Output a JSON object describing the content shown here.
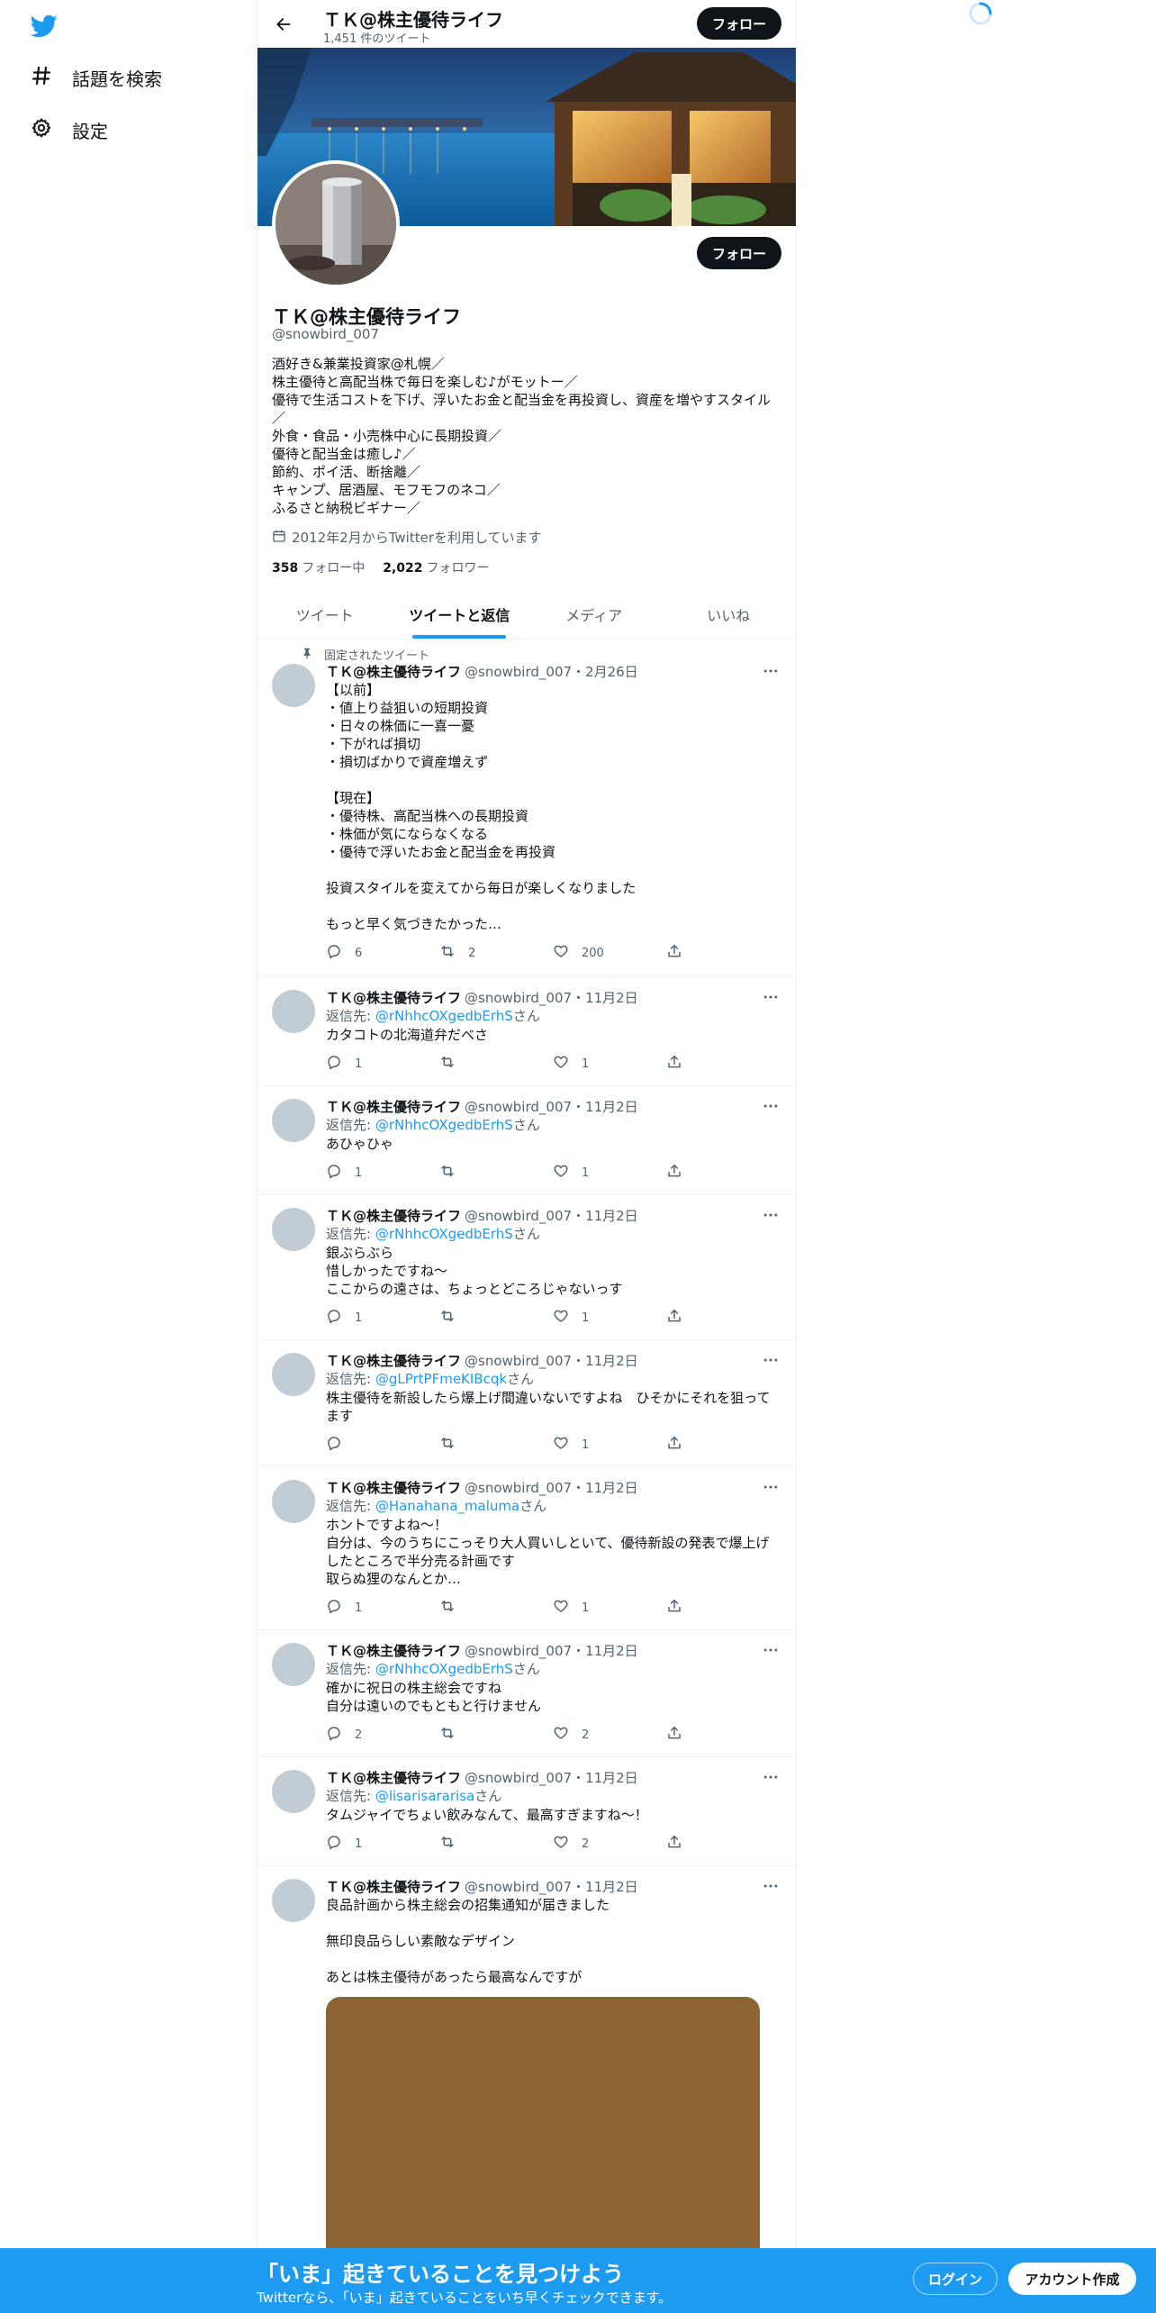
{
  "nav": {
    "logo_icon": "twitter-bird-icon",
    "items": [
      {
        "label": "話題を検索",
        "icon": "hashtag-icon"
      },
      {
        "label": "設定",
        "icon": "gear-icon"
      }
    ]
  },
  "header": {
    "title": "ＴＫ@株主優待ライフ",
    "tweet_count": "1,451 件のツイート",
    "follow_label": "フォロー"
  },
  "profile": {
    "name": "ＴＫ@株主優待ライフ",
    "handle": "@snowbird_007",
    "follow_label": "フォロー",
    "bio": [
      "酒好き&兼業投資家@札幌／",
      "株主優待と高配当株で毎日を楽しむ♪がモットー／",
      "優待で生活コストを下げ、浮いたお金と配当金を再投資し、資産を増やすスタイル",
      "／",
      "外食・食品・小売株中心に長期投資／",
      "優待と配当金は癒し♪／",
      "節約、ポイ活、断捨離／",
      "キャンプ、居酒屋、モフモフのネコ／",
      "ふるさと納税ビギナー／"
    ],
    "joined": "2012年2月からTwitterを利用しています",
    "following_count": "358",
    "following_label": "フォロー中",
    "followers_count": "2,022",
    "followers_label": "フォロワー"
  },
  "tabs": [
    {
      "label": "ツイート",
      "active": false
    },
    {
      "label": "ツイートと返信",
      "active": true
    },
    {
      "label": "メディア",
      "active": false
    },
    {
      "label": "いいね",
      "active": false
    }
  ],
  "tweets": [
    {
      "pinned_label": "固定されたツイート",
      "name": "ＴＫ@株主優待ライフ",
      "meta": "@snowbird_007・2月26日",
      "reply_prefix": "",
      "reply_to": "",
      "reply_suffix": "",
      "text": [
        "【以前】",
        "・値上り益狙いの短期投資",
        "・日々の株価に一喜一憂",
        "・下がれば損切",
        "・損切ばかりで資産増えず",
        "",
        "【現在】",
        "・優待株、高配当株への長期投資",
        "・株価が気にならなくなる",
        "・優待で浮いたお金と配当金を再投資",
        "",
        "投資スタイルを変えてから毎日が楽しくなりました",
        "",
        "もっと早く気づきたかった…"
      ],
      "replies": "6",
      "retweets": "2",
      "likes": "200"
    },
    {
      "name": "ＴＫ@株主優待ライフ",
      "meta": "@snowbird_007・11月2日",
      "reply_prefix": "返信先: ",
      "reply_to": "@rNhhcOXgedbErhS",
      "reply_suffix": "さん",
      "text": [
        "カタコトの北海道弁だべさ"
      ],
      "replies": "1",
      "retweets": "",
      "likes": "1"
    },
    {
      "name": "ＴＫ@株主優待ライフ",
      "meta": "@snowbird_007・11月2日",
      "reply_prefix": "返信先: ",
      "reply_to": "@rNhhcOXgedbErhS",
      "reply_suffix": "さん",
      "text": [
        "あひゃひゃ"
      ],
      "replies": "1",
      "retweets": "",
      "likes": "1"
    },
    {
      "name": "ＴＫ@株主優待ライフ",
      "meta": "@snowbird_007・11月2日",
      "reply_prefix": "返信先: ",
      "reply_to": "@rNhhcOXgedbErhS",
      "reply_suffix": "さん",
      "text": [
        "銀ぶらぶら",
        "惜しかったですね〜",
        "ここからの遠さは、ちょっとどころじゃないっす"
      ],
      "replies": "1",
      "retweets": "",
      "likes": "1"
    },
    {
      "name": "ＴＫ@株主優待ライフ",
      "meta": "@snowbird_007・11月2日",
      "reply_prefix": "返信先: ",
      "reply_to": "@gLPrtPFmeKIBcqk",
      "reply_suffix": "さん",
      "text": [
        "株主優待を新設したら爆上げ間違いないですよね　ひそかにそれを狙って",
        "ます"
      ],
      "replies": "",
      "retweets": "",
      "likes": "1"
    },
    {
      "name": "ＴＫ@株主優待ライフ",
      "meta": "@snowbird_007・11月2日",
      "reply_prefix": "返信先: ",
      "reply_to": "@Hanahana_maluma",
      "reply_suffix": "さん",
      "text": [
        "ホントですよね〜！",
        "自分は、今のうちにこっそり大人買いしといて、優待新設の発表で爆上げ",
        "したところで半分売る計画です",
        "取らぬ狸のなんとか…"
      ],
      "replies": "1",
      "retweets": "",
      "likes": "1"
    },
    {
      "name": "ＴＫ@株主優待ライフ",
      "meta": "@snowbird_007・11月2日",
      "reply_prefix": "返信先: ",
      "reply_to": "@rNhhcOXgedbErhS",
      "reply_suffix": "さん",
      "text": [
        "確かに祝日の株主総会ですね",
        "自分は遠いのでもともと行けません"
      ],
      "replies": "2",
      "retweets": "",
      "likes": "2"
    },
    {
      "name": "ＴＫ@株主優待ライフ",
      "meta": "@snowbird_007・11月2日",
      "reply_prefix": "返信先: ",
      "reply_to": "@lisarisararisa",
      "reply_suffix": "さん",
      "text": [
        "タムジャイでちょい飲みなんて、最高すぎますね〜！"
      ],
      "replies": "1",
      "retweets": "",
      "likes": "2"
    },
    {
      "name": "ＴＫ@株主優待ライフ",
      "meta": "@snowbird_007・11月2日",
      "reply_prefix": "",
      "reply_to": "",
      "reply_suffix": "",
      "text": [
        "良品計画から株主総会の招集通知が届きました",
        "",
        "無印良品らしい素敵なデザイン",
        "",
        "あとは株主優待があったら最高なんですが"
      ],
      "replies": "",
      "retweets": "",
      "likes": ""
    }
  ],
  "bottom_bar": {
    "title": "「いま」起きていることを見つけよう",
    "subtitle": "Twitterなら、「いま」起きていることをいち早くチェックできます。",
    "login_label": "ログイン",
    "signup_label": "アカウント作成"
  },
  "colors": {
    "accent": "#1d9bf0",
    "text": "#0f1419",
    "secondary": "#536471",
    "media_placeholder": "#8d6535"
  }
}
